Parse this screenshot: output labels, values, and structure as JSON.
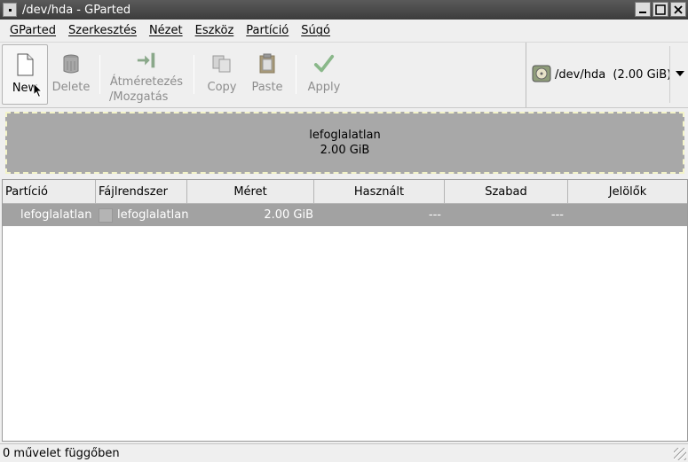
{
  "window": {
    "title": "/dev/hda - GParted"
  },
  "menubar": {
    "items": [
      "GParted",
      "Szerkesztés",
      "Nézet",
      "Eszköz",
      "Partíció",
      "Súgó"
    ]
  },
  "toolbar": {
    "new_label": "New",
    "delete_label": "Delete",
    "resize_label_line1": "Átméretezés",
    "resize_label_line2": "/Mozgatás",
    "copy_label": "Copy",
    "paste_label": "Paste",
    "apply_label": "Apply",
    "device_selector": "/dev/hda  (2.00 GiB)"
  },
  "disk_graphic": {
    "label": "lefoglalatlan",
    "size": "2.00 GiB"
  },
  "table": {
    "columns": [
      "Partíció",
      "Fájlrendszer",
      "Méret",
      "Használt",
      "Szabad",
      "Jelölők"
    ],
    "rows": [
      {
        "partition": "lefoglalatlan",
        "filesystem": "lefoglalatlan",
        "size": "2.00 GiB",
        "used": "---",
        "free": "---",
        "flags": ""
      }
    ]
  },
  "statusbar": {
    "text": "0 művelet függőben"
  },
  "colors": {
    "selected_row": "#a2a2a2",
    "unallocated": "#a8a8a8",
    "apply_green": "#5aa63c",
    "titlebar": "#4a4a4a"
  }
}
